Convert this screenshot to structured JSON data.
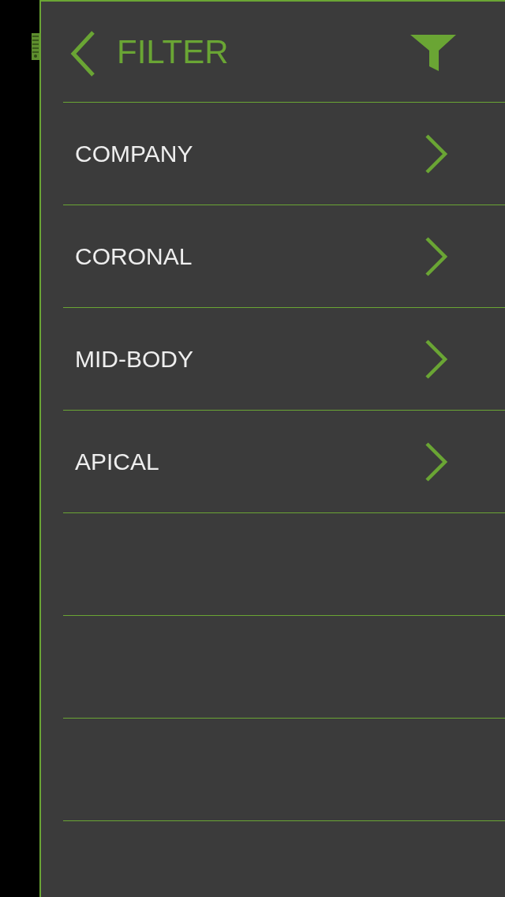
{
  "header": {
    "title": "FILTER"
  },
  "filter_items": [
    {
      "label": "COMPANY"
    },
    {
      "label": "CORONAL"
    },
    {
      "label": "MID-BODY"
    },
    {
      "label": "APICAL"
    }
  ]
}
